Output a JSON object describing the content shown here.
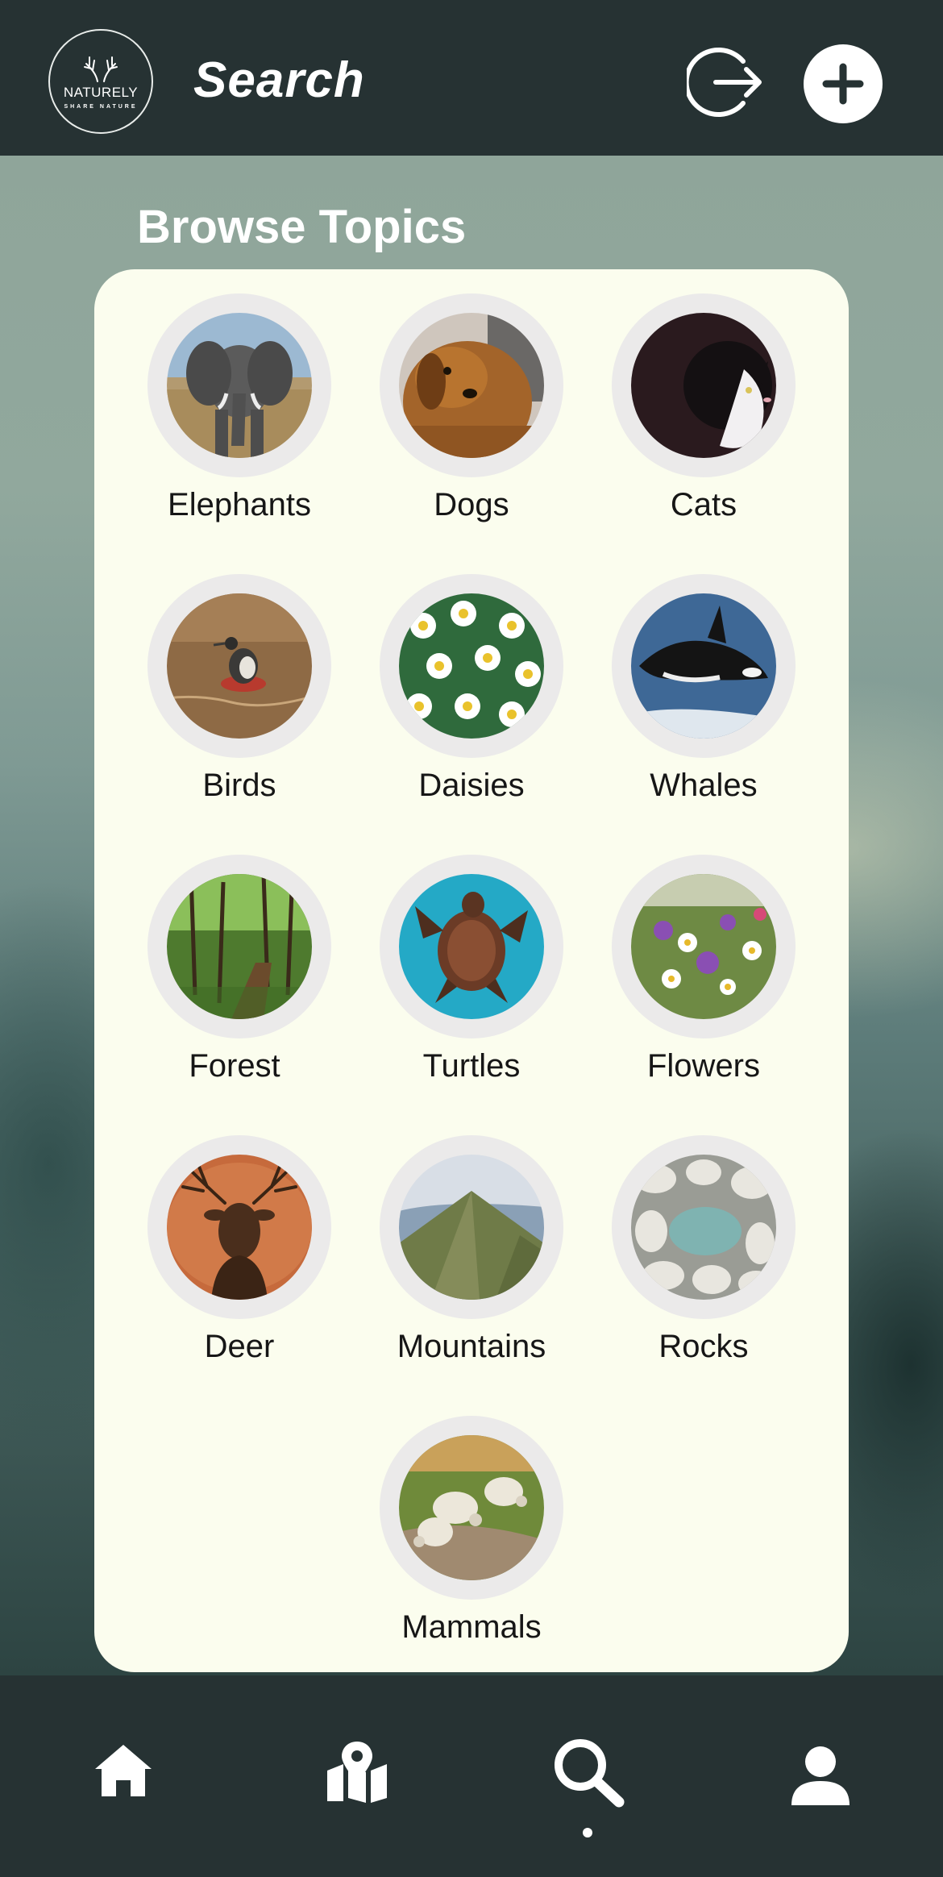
{
  "header": {
    "logo_name": "NATURELY",
    "logo_tagline": "SHARE NATURE",
    "title": "Search",
    "logout_icon": "logout-arrow-icon",
    "add_icon": "plus-icon"
  },
  "main": {
    "section_title": "Browse Topics",
    "topics": [
      {
        "label": "Elephants",
        "image": "elephant-photo"
      },
      {
        "label": "Dogs",
        "image": "dog-photo"
      },
      {
        "label": "Cats",
        "image": "cat-photo"
      },
      {
        "label": "Birds",
        "image": "bird-photo"
      },
      {
        "label": "Daisies",
        "image": "daisies-photo"
      },
      {
        "label": "Whales",
        "image": "orca-photo"
      },
      {
        "label": "Forest",
        "image": "forest-photo"
      },
      {
        "label": "Turtles",
        "image": "sea-turtle-photo"
      },
      {
        "label": "Flowers",
        "image": "wildflowers-photo"
      },
      {
        "label": "Deer",
        "image": "stag-photo"
      },
      {
        "label": "Mountains",
        "image": "mountain-photo"
      },
      {
        "label": "Rocks",
        "image": "pebbles-photo"
      },
      {
        "label": "Mammals",
        "image": "sheep-photo"
      }
    ]
  },
  "bottom_nav": {
    "items": [
      {
        "icon": "home-icon"
      },
      {
        "icon": "map-icon"
      },
      {
        "icon": "search-icon",
        "active": true
      },
      {
        "icon": "user-icon"
      }
    ]
  },
  "colors": {
    "bar": "#263233",
    "card": "#fbfdee",
    "ring": "#ebeaea",
    "text": "#161616",
    "white": "#ffffff"
  }
}
